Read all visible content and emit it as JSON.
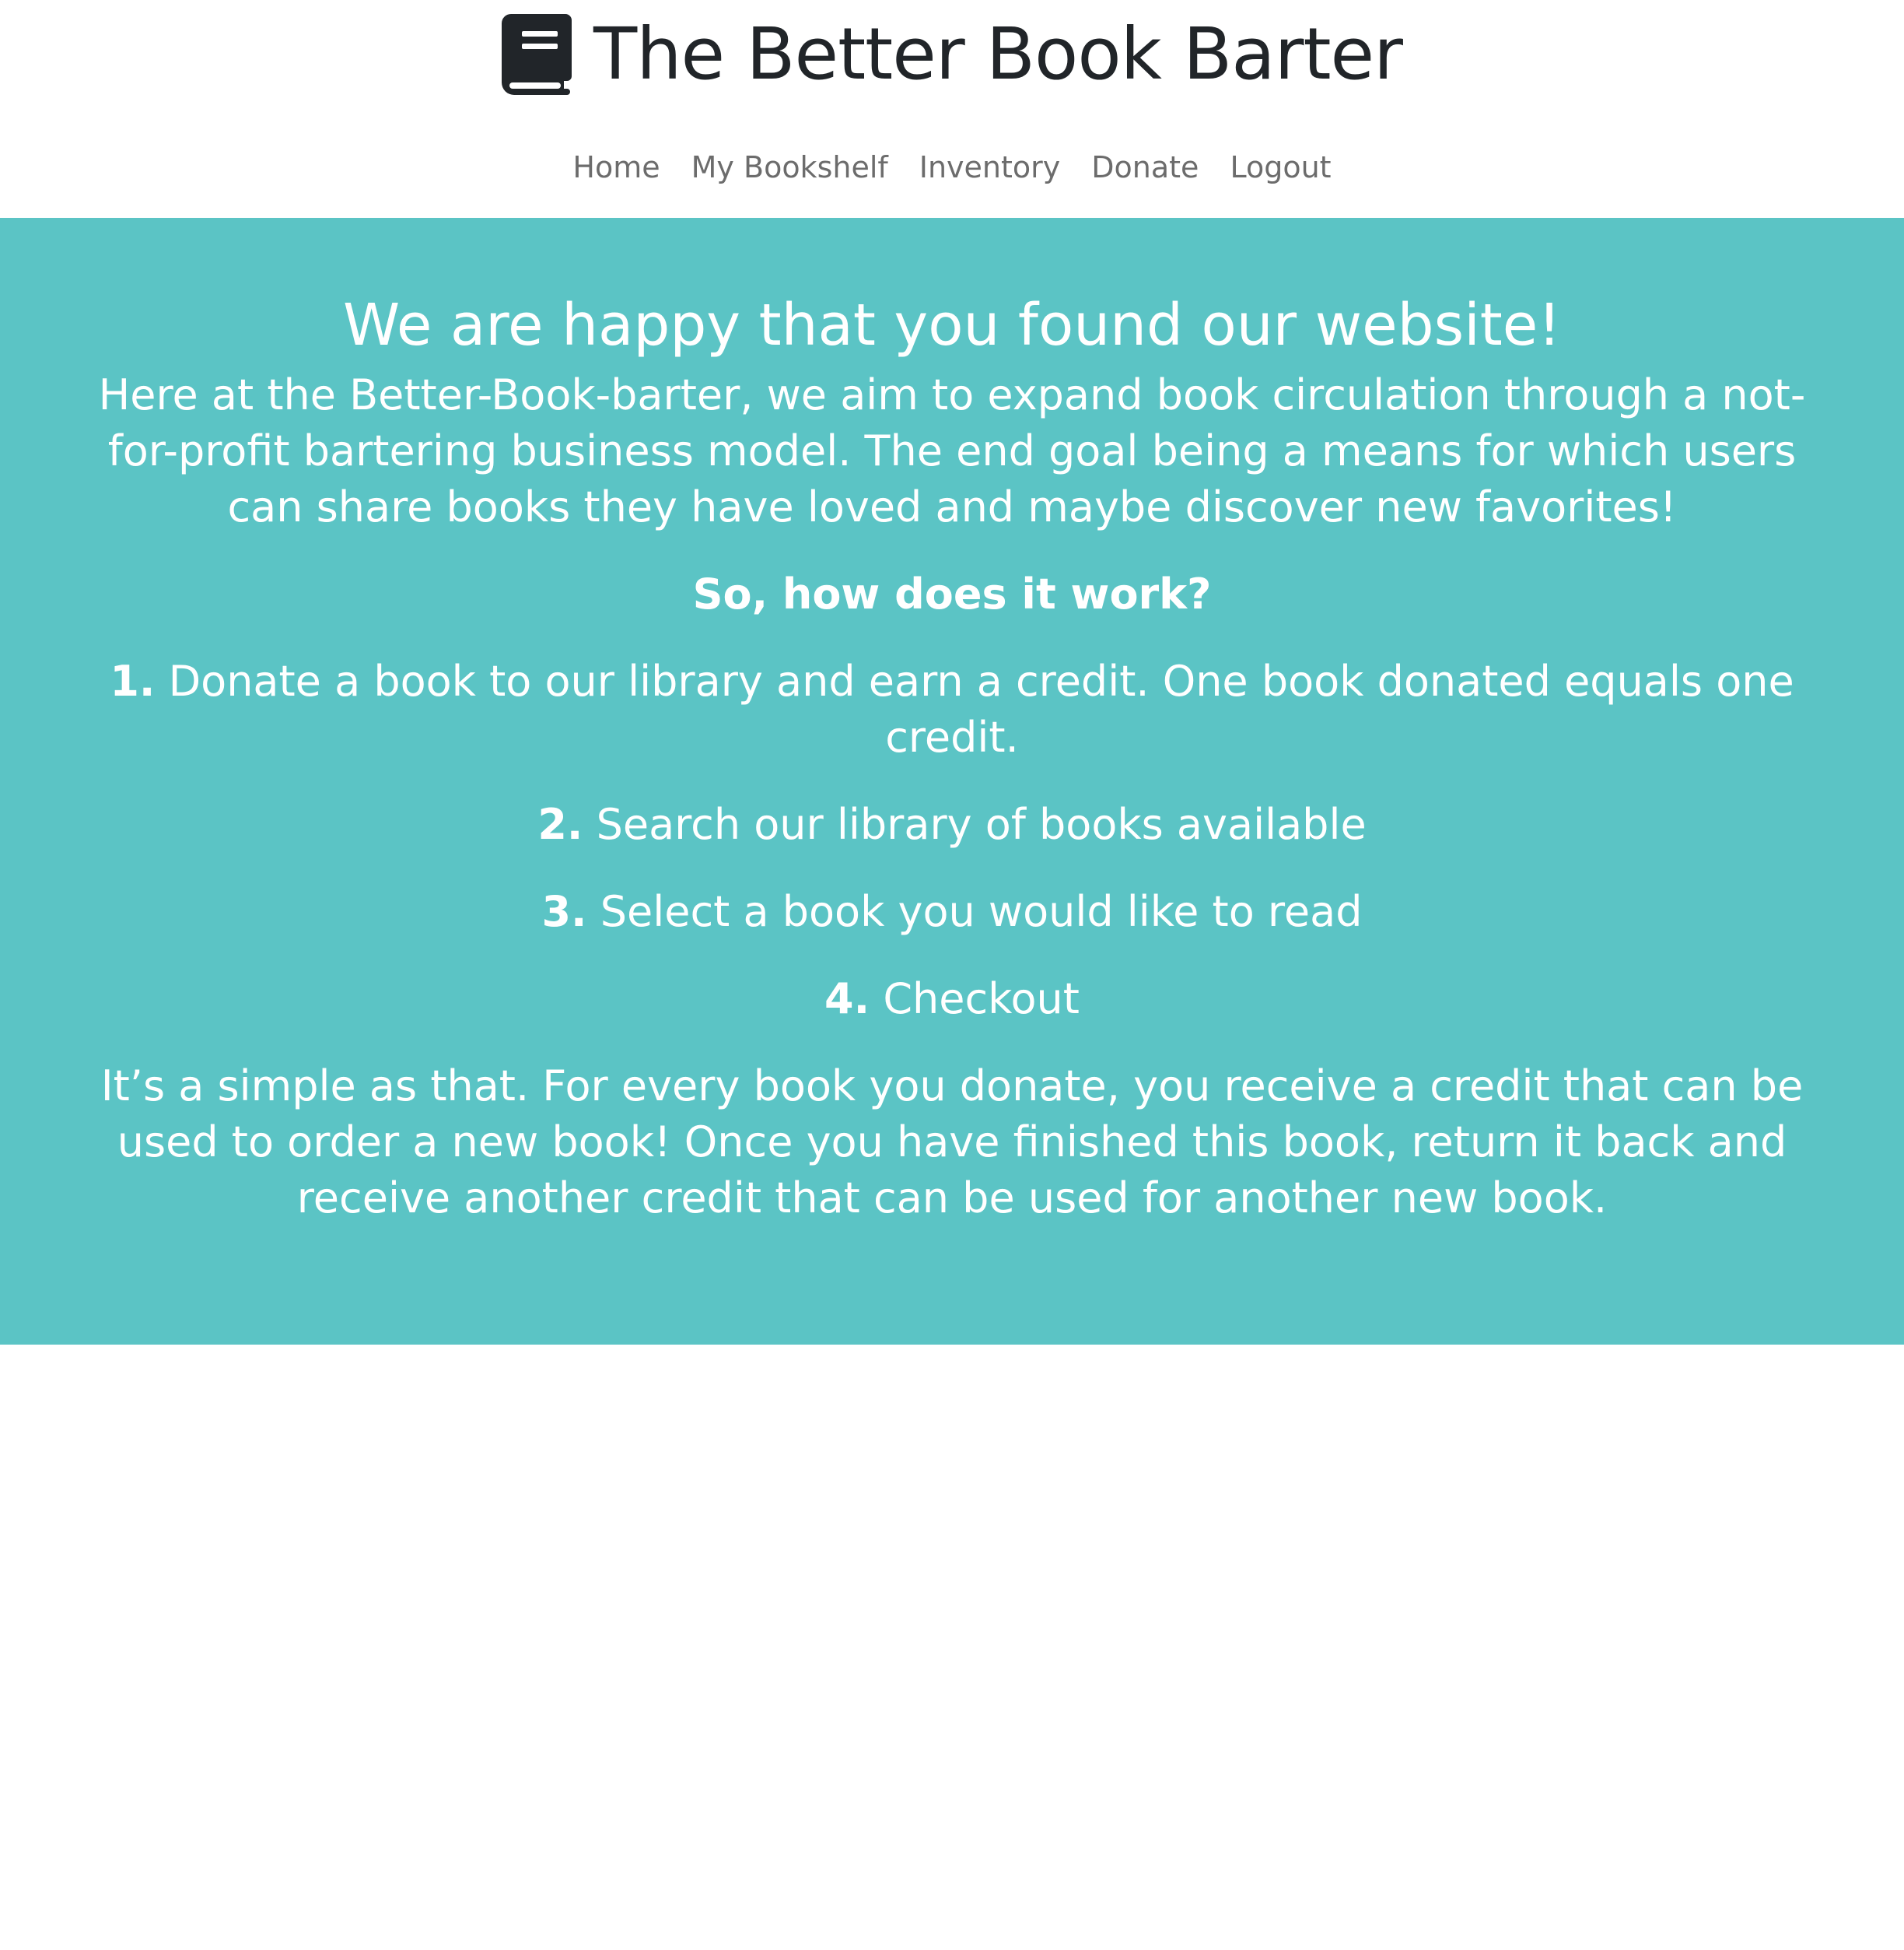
{
  "header": {
    "brand_icon": "book-icon",
    "title": "The Better Book Barter"
  },
  "nav": {
    "items": [
      "Home",
      "My Bookshelf",
      "Inventory",
      "Donate",
      "Logout"
    ]
  },
  "hero": {
    "background_color": "#5bc4c5",
    "heading": "We are happy that you found our website!",
    "intro": "Here at the Better-Book-barter, we aim to expand book circulation through a not-for-profit bartering business model. The end goal being a means for which users can share books they have loved and maybe discover new favorites!",
    "subheading": "So, how does it work?",
    "steps": [
      {
        "number": "1.",
        "text": "Donate a book to our library and earn a credit. One book donated equals one credit."
      },
      {
        "number": "2.",
        "text": "Search our library of books available"
      },
      {
        "number": "3.",
        "text": "Select a book you would like to read"
      },
      {
        "number": "4.",
        "text": "Checkout"
      }
    ],
    "closing": "It’s a simple as that. For every book you donate, you receive a credit that can be used to order a new book! Once you have finished this book, return it back and receive another credit that can be used for another new book."
  }
}
